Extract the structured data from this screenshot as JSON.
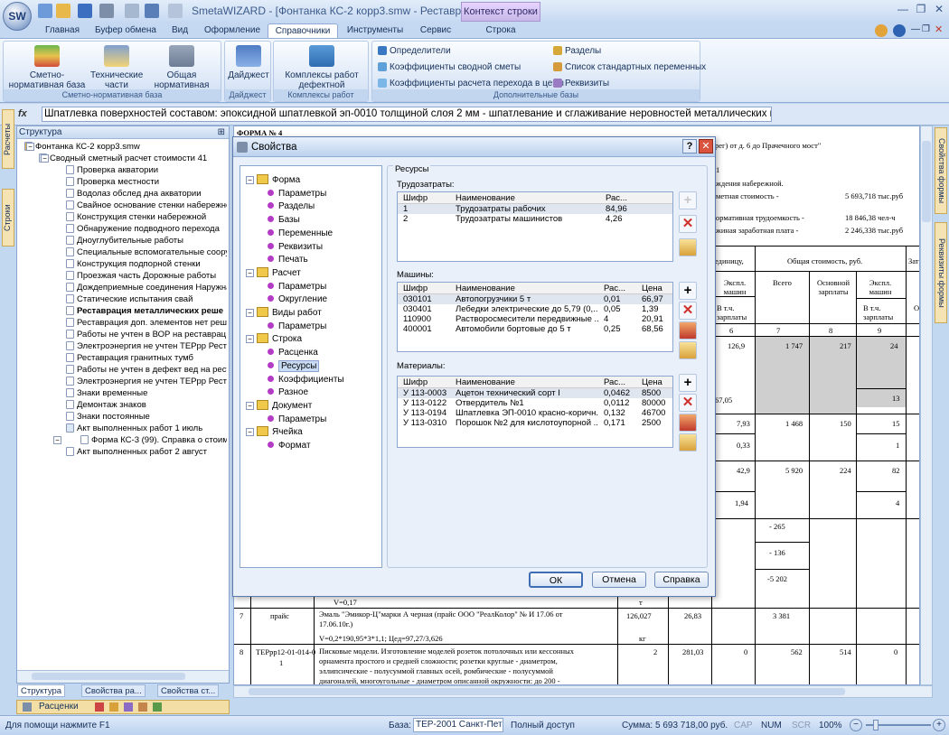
{
  "window": {
    "title": "SmetaWIZARD - [Фонтанка КС-2 корр3.smw - Реставраци...",
    "context_tab": "Контекст строки",
    "logo_text": "SW"
  },
  "tabs": [
    "Главная",
    "Буфер обмена",
    "Вид",
    "Оформление",
    "Справочники",
    "Инструменты",
    "Сервис",
    "Строка"
  ],
  "ribbon": {
    "group1": {
      "title": "Сметно-нормативная база",
      "buttons": [
        "Сметно-нормативная база",
        "Технические части",
        "Общая нормативная документация"
      ]
    },
    "group2": {
      "title": "Дайджест",
      "buttons": [
        "Дайджест"
      ]
    },
    "group3": {
      "title": "Комплексы работ",
      "buttons": [
        "Комплексы работ дефектной ведомости"
      ]
    },
    "group4": {
      "title": "Дополнительные базы",
      "items": [
        "Определители",
        "Коэффициенты сводной сметы",
        "Коэффициенты расчета перехода в цены",
        "Разделы",
        "Список стандартных переменных",
        "Реквизиты"
      ]
    }
  },
  "formula": {
    "text": "Шпатлевка поверхностей составом: эпоксидной шпатлевкой эп-0010 толщиной слоя 2 мм - шпатлевание и сглаживание неровностей металлических поверхностей"
  },
  "left_tabs": [
    "Расчеты",
    "Строки"
  ],
  "right_tabs": [
    "Свойства формы",
    "Реквизиты формы"
  ],
  "structure": {
    "title": "Структура",
    "nodes": [
      "Фонтанка КС-2 корр3.smw",
      "Сводный сметный расчет стоимости 41",
      "Проверка акватории",
      "Проверка местности",
      "Водолаз обслед  дна акватории",
      "Свайное основание стенки набережно",
      "Конструкция стенки набережной",
      "Обнаружение подводного перехода",
      "Дноуглубительные работы",
      "Специальные вспомогательные соору:",
      "Конструкция подпорной стенки",
      "Проезжая часть Дорожные работы",
      "Дождеприемные соединения Наружна",
      "Статические испытания свай",
      "Реставрация металлических реше",
      "Реставрация доп. элементов нет реше",
      "Работы не учтен в ВОР на реставрац н",
      "Электроэнергия не учтен ТЕРрр  Реста",
      "Реставрация гранитных тумб",
      "Работы не учтен в дефект вед  на рест",
      "Электроэнергия не учтен ТЕРрр  Реста",
      "Знаки временные",
      "Демонтаж знаков",
      "Знаки постоянные",
      "Акт выполненных работ 1 июль",
      "Форма КС-3 (99). Справка о стоимо",
      "Акт выполненных работ 2 август"
    ]
  },
  "panel_tabs": [
    "Структура",
    "Свойства ра...",
    "Свойства ст..."
  ],
  "rascenki_bar": "Расценки",
  "document": {
    "forma": "ФОРМА № 4",
    "line1": "рег) от д. 6 до Прачечного мост\"",
    "line2": "1",
    "line3": "ждения набережной.",
    "line4_label": "метная стоимость -",
    "line4_value": "5 693,718 тыс.руб",
    "line5_label": "ормативная трудоемкость -",
    "line5_value": "18 846,38 чел-ч",
    "line6_label": "жиная заработная плата -",
    "line6_value": "2 246,338 тыс.руб",
    "h_unit": "единицу,",
    "h_total": "Общая стоимость, руб.",
    "h_zatr": "Затр",
    "h_eksp1": "Экспл. машин",
    "h_vsego": "Всего",
    "h_osn": "Основной зарплаты",
    "h_eksp2": "Экспл. машин",
    "h_vtch1": "В т.ч. зарплаты",
    "h_vtch2": "В т.ч. зарплаты",
    "h_o": "О",
    "colnums": [
      "6",
      "7",
      "8",
      "9"
    ],
    "rows": [
      {
        "c6": "126,9",
        "c7": "1 747",
        "c8": "217",
        "c9": "24"
      },
      {
        "c6": "67,05",
        "c7": "",
        "c8": "",
        "c9": "13"
      },
      {
        "c6": "7,93",
        "c7": "1 468",
        "c8": "150",
        "c9": "15"
      },
      {
        "c6": "0,33",
        "c7": "",
        "c8": "",
        "c9": "1"
      },
      {
        "c6": "42,9",
        "c7": "5 920",
        "c8": "224",
        "c9": "82"
      },
      {
        "c6": "1,94",
        "c7": "",
        "c8": "",
        "c9": "4"
      }
    ],
    "neg1": "- 265",
    "neg2": "- 136",
    "neg3": "-5 202",
    "v017": "V=0,17",
    "t_mark": "т",
    "r7_num": "7",
    "r7_code": "прайс",
    "r7_text1": "Эмаль \"Эмикор-Ц\"марки А черная (прайс ООО \"РеалКолор\" № И 17.06 от",
    "r7_text2": "17.06.10г.)",
    "r7_text3": "V=0,2*190,95*3*1,1; Цед=97,27/3,626",
    "r7_qty": "126,027",
    "r7_unit": "кг",
    "r7_price": "26,83",
    "r7_total": "3 381",
    "r8_num": "8",
    "r8_code": "ТЕРрр12-01-014-0",
    "r8_code2": "1",
    "r8_text": [
      "Писковые модели. Изготовление моделей розеток потолочных или кессонных",
      "орнамента простого и средней сложности; розетки круглые - диаметром,",
      "эллипсические - полусуммой главных осей, ромбические - полусуммой",
      "диагоналей, многоугольные - диаметром описанной окружности: до 200 -"
    ],
    "r8_qty": "2",
    "r8_price": "281,03",
    "r8_c6": "0",
    "r8_c7": "562",
    "r8_c8": "514",
    "r8_c9": "0"
  },
  "dialog": {
    "title": "Свойства",
    "tree": [
      {
        "label": "Форма",
        "level": 0,
        "type": "folder"
      },
      {
        "label": "Параметры",
        "level": 1
      },
      {
        "label": "Разделы",
        "level": 1
      },
      {
        "label": "Базы",
        "level": 1
      },
      {
        "label": "Переменные",
        "level": 1
      },
      {
        "label": "Реквизиты",
        "level": 1
      },
      {
        "label": "Печать",
        "level": 1
      },
      {
        "label": "Расчет",
        "level": 0,
        "type": "folder"
      },
      {
        "label": "Параметры",
        "level": 1
      },
      {
        "label": "Округление",
        "level": 1
      },
      {
        "label": "Виды работ",
        "level": 0,
        "type": "folder"
      },
      {
        "label": "Параметры",
        "level": 1
      },
      {
        "label": "Строка",
        "level": 0,
        "type": "folder"
      },
      {
        "label": "Расценка",
        "level": 1
      },
      {
        "label": "Ресурсы",
        "level": 1,
        "selected": true
      },
      {
        "label": "Коэффициенты",
        "level": 1
      },
      {
        "label": "Разное",
        "level": 1
      },
      {
        "label": "Документ",
        "level": 0,
        "type": "folder"
      },
      {
        "label": "Параметры",
        "level": 1
      },
      {
        "label": "Ячейка",
        "level": 0,
        "type": "folder"
      },
      {
        "label": "Формат",
        "level": 1
      }
    ],
    "section": "Ресурсы",
    "labor": {
      "label": "Трудозатраты:",
      "cols": [
        "Шифр",
        "Наименование",
        "Рас..."
      ],
      "rows": [
        [
          "1",
          "Трудозатраты рабочих",
          "84,96"
        ],
        [
          "2",
          "Трудозатраты машинистов",
          "4,26"
        ]
      ]
    },
    "machines": {
      "label": "Машины:",
      "cols": [
        "Шифр",
        "Наименование",
        "Рас...",
        "Цена"
      ],
      "rows": [
        [
          "030101",
          "Автопогрузчики 5 т",
          "0,01",
          "66,97"
        ],
        [
          "030401",
          "Лебедки электрические до 5,79 (0,...",
          "0,05",
          "1,39"
        ],
        [
          "110900",
          "Растворосмесители передвижные ...",
          "4",
          "20,91"
        ],
        [
          "400001",
          "Автомобили бортовые до 5 т",
          "0,25",
          "68,56"
        ]
      ]
    },
    "materials": {
      "label": "Материалы:",
      "cols": [
        "Шифр",
        "Наименование",
        "Рас...",
        "Цена"
      ],
      "rows": [
        [
          "У 113-0003",
          "Ацетон технический сорт I",
          "0,0462",
          "8500"
        ],
        [
          "У 113-0122",
          "Отвердитель №1",
          "0,0112",
          "80000"
        ],
        [
          "У 113-0194",
          "Шпатлевка ЭП-0010 красно-коричн...",
          "0,132",
          "46700"
        ],
        [
          "У 113-0310",
          "Порошок №2 для кислотоупорной ...",
          "0,171",
          "2500"
        ]
      ]
    },
    "buttons": {
      "ok": "ОК",
      "cancel": "Отмена",
      "help": "Справка"
    }
  },
  "status": {
    "help": "Для помощи нажмите F1",
    "base_label": "База:",
    "base_value": "ТЕР-2001 Санкт-Пете",
    "access": "Полный доступ",
    "sum": "Сумма: 5 693 718,00 руб.",
    "cap": "CAP",
    "num": "NUM",
    "scr": "SCR",
    "zoom": "100%"
  }
}
